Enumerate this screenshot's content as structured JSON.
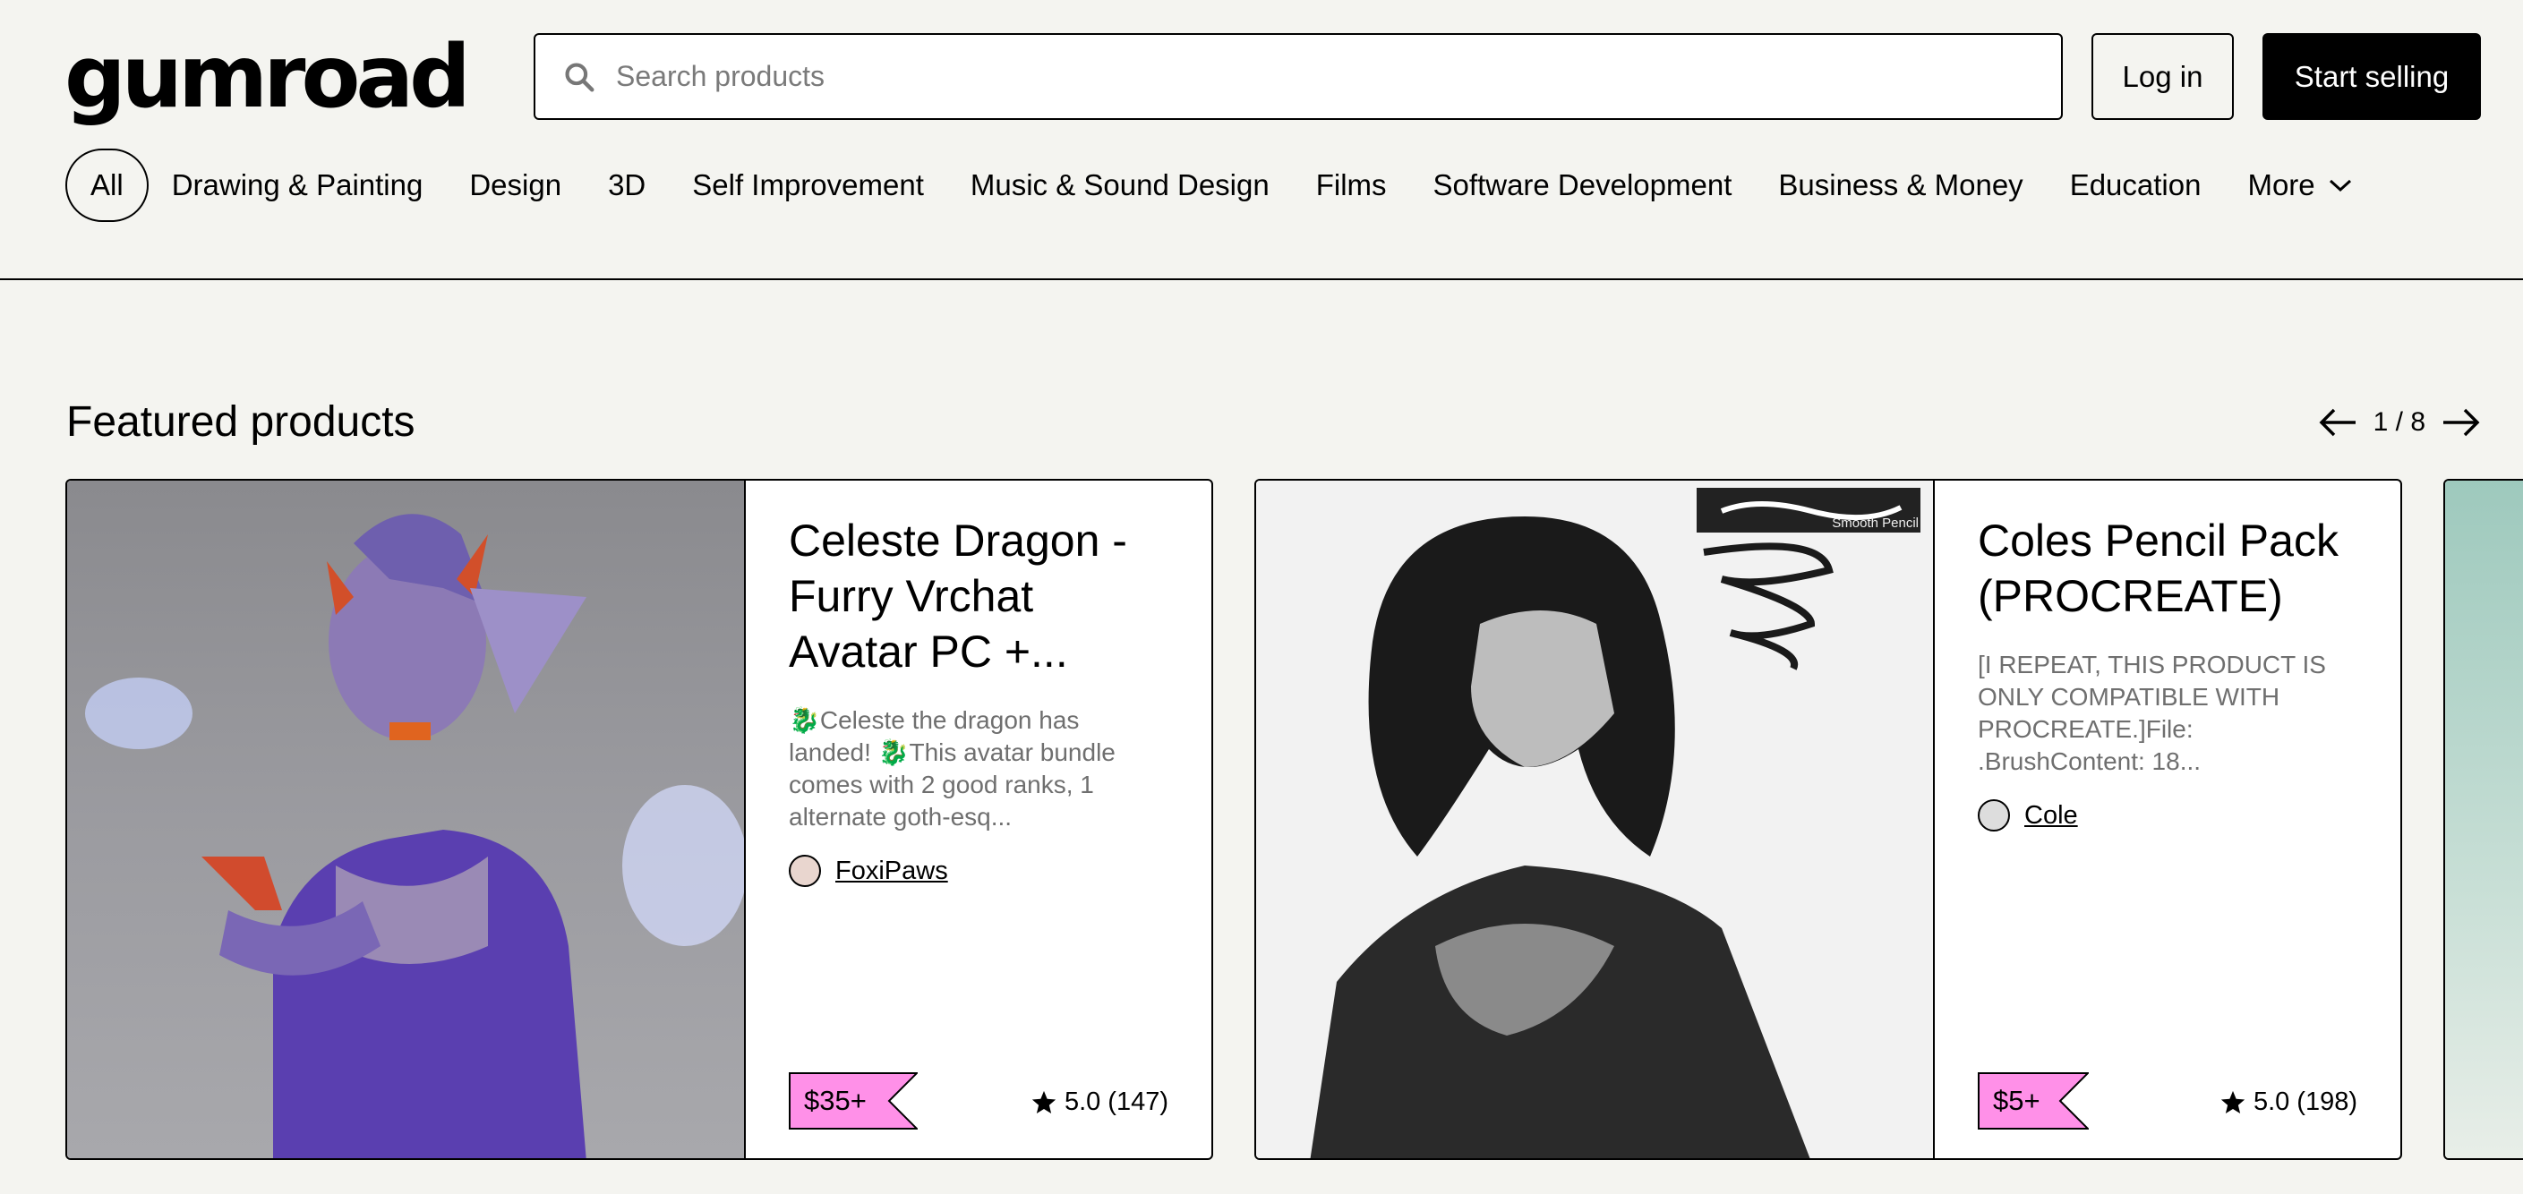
{
  "header": {
    "logo": "gumroad",
    "search_placeholder": "Search products",
    "login_label": "Log in",
    "start_selling_label": "Start selling"
  },
  "nav": {
    "items": [
      {
        "label": "All",
        "active": true
      },
      {
        "label": "Drawing & Painting"
      },
      {
        "label": "Design"
      },
      {
        "label": "3D"
      },
      {
        "label": "Self Improvement"
      },
      {
        "label": "Music & Sound Design"
      },
      {
        "label": "Films"
      },
      {
        "label": "Software Development"
      },
      {
        "label": "Business & Money"
      },
      {
        "label": "Education"
      },
      {
        "label": "More"
      }
    ]
  },
  "featured": {
    "title": "Featured products",
    "pager": "1 / 8"
  },
  "products": [
    {
      "title": "Celeste Dragon - Furry Vrchat Avatar PC +...",
      "description": "🐉Celeste the dragon has landed! 🐉This avatar bundle comes with 2 good ranks, 1 alternate goth-esq...",
      "seller": "FoxiPaws",
      "price": "$35+",
      "rating": "5.0",
      "reviews": "(147)"
    },
    {
      "title": "Coles Pencil Pack (PROCREATE)",
      "description": "[I REPEAT, THIS PRODUCT IS ONLY COMPATIBLE WITH PROCREATE.]File: .BrushContent: 18...",
      "seller": "Cole",
      "price": "$5+",
      "rating": "5.0",
      "reviews": "(198)",
      "thumb_label": "Smooth Pencil"
    }
  ],
  "colors": {
    "background": "#f4f4f0",
    "price_tag": "#ff90e8",
    "accent": "#000000"
  }
}
